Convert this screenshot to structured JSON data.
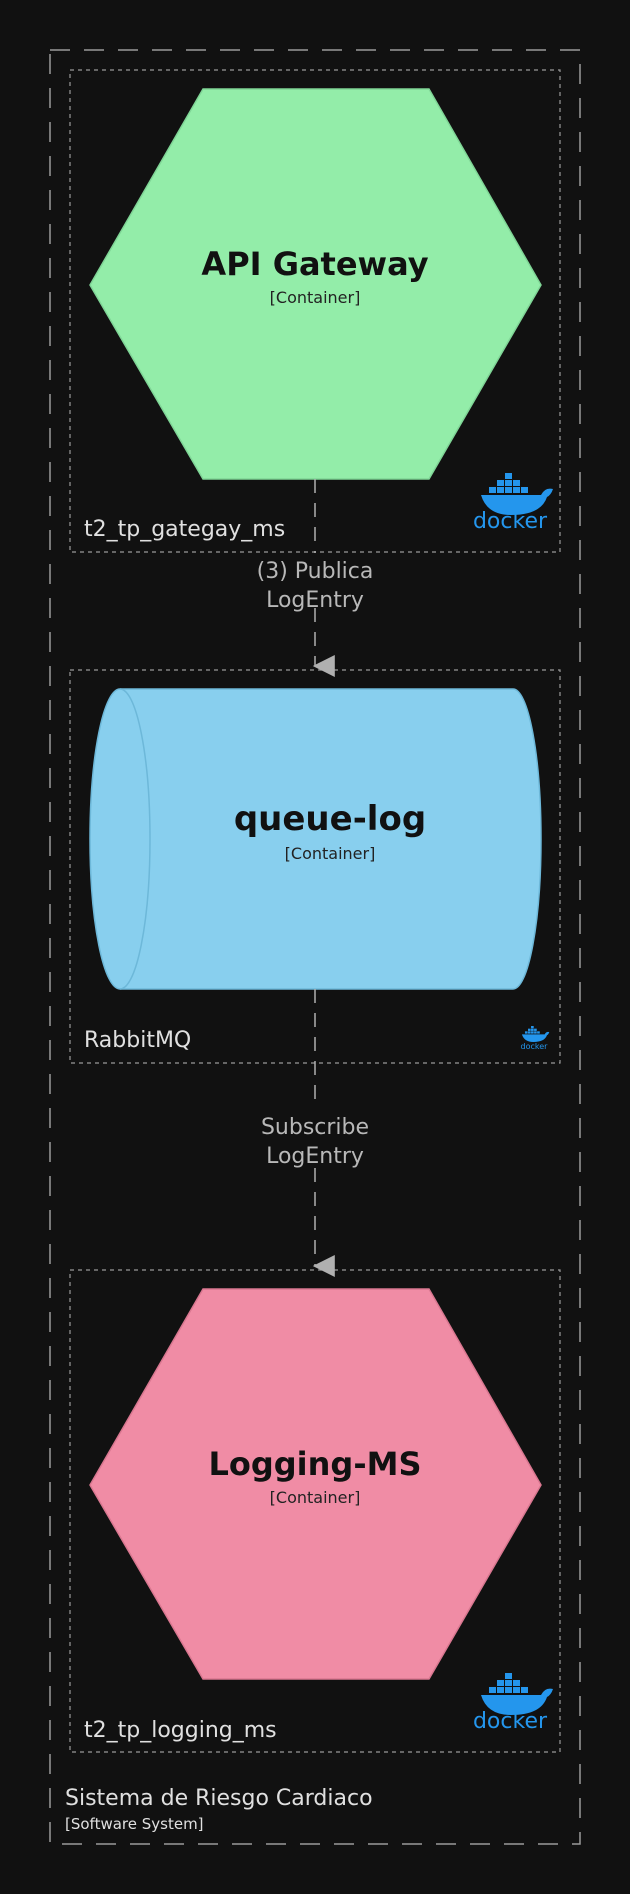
{
  "system": {
    "name": "Sistema de Riesgo Cardiaco",
    "type": "[Software System]"
  },
  "groups": [
    {
      "label": "t2_tp_gategay_ms",
      "icon": "docker-icon",
      "icon_text": "docker"
    },
    {
      "label": "RabbitMQ",
      "icon": "docker-icon",
      "icon_text": "docker"
    },
    {
      "label": "t2_tp_logging_ms",
      "icon": "docker-icon",
      "icon_text": "docker"
    }
  ],
  "containers": [
    {
      "name": "API Gateway",
      "type": "[Container]",
      "shape": "hexagon",
      "color": "#93eda9"
    },
    {
      "name": "queue-log",
      "type": "[Container]",
      "shape": "cylinder",
      "color": "#88cfee"
    },
    {
      "name": "Logging-MS",
      "type": "[Container]",
      "shape": "hexagon",
      "color": "#f08ca5"
    }
  ],
  "edges": [
    {
      "line1": "(3) Publica",
      "line2": "LogEntry"
    },
    {
      "line1": "Subscribe",
      "line2": "LogEntry"
    }
  ],
  "colors": {
    "background": "#111111",
    "boundary": "#9a9a9a",
    "edge": "#b0b0b0",
    "docker": "#2496ed"
  }
}
